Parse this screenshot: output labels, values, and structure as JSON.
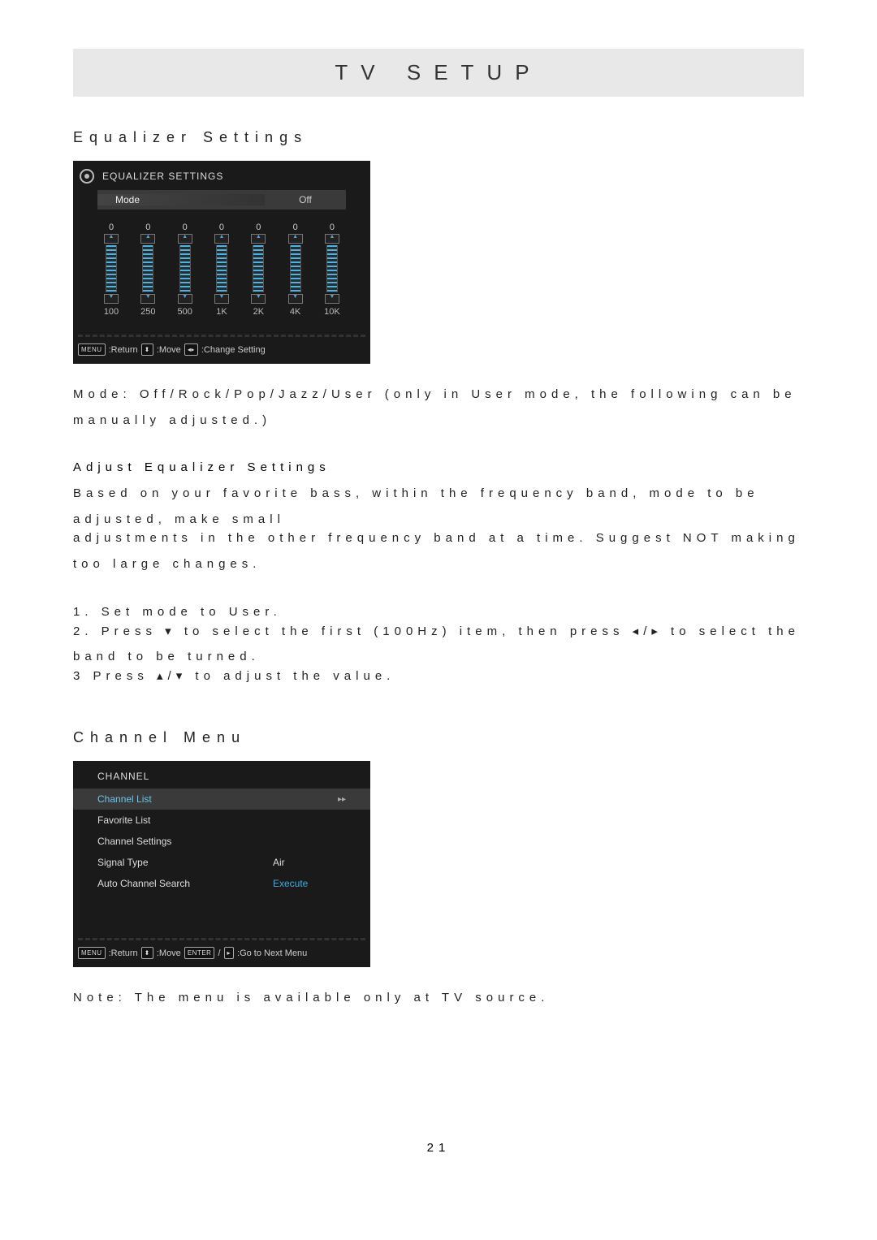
{
  "page": {
    "title": "TV SETUP",
    "number": "21"
  },
  "sections": {
    "equalizer_title": "Equalizer Settings",
    "channel_title": "Channel Menu"
  },
  "equalizer_panel": {
    "title": "EQUALIZER SETTINGS",
    "mode_label": "Mode",
    "mode_value": "Off",
    "bands": [
      {
        "value": "0",
        "freq": "100"
      },
      {
        "value": "0",
        "freq": "250"
      },
      {
        "value": "0",
        "freq": "500"
      },
      {
        "value": "0",
        "freq": "1K"
      },
      {
        "value": "0",
        "freq": "2K"
      },
      {
        "value": "0",
        "freq": "4K"
      },
      {
        "value": "0",
        "freq": "10K"
      }
    ],
    "hints": {
      "menu": "MENU",
      "return": ":Return",
      "move_key": "⬍",
      "move": ":Move",
      "lr_key": "◂▸",
      "change": ":Change Setting"
    }
  },
  "text": {
    "modes": "Mode: Off/Rock/Pop/Jazz/User (only in User mode, the following can be manually adjusted.)",
    "adjust_heading": "Adjust Equalizer Settings",
    "adjust_p1": "Based on your favorite bass, within the frequency band, mode to be adjusted, make small",
    "adjust_p2": "adjustments in the other frequency band at a time. Suggest NOT making too large changes.",
    "step1": "1. Set mode to User.",
    "step2": "2. Press ▾ to select the first (100Hz) item, then press ◂/▸ to select the band to be turned.",
    "step3": "3 Press ▴/▾ to adjust the value.",
    "note": "Note: The menu is available only at TV source."
  },
  "channel_panel": {
    "title": "CHANNEL",
    "rows": [
      {
        "label": "Channel List",
        "value": "",
        "selected": true,
        "arrow": "▸▸"
      },
      {
        "label": "Favorite List",
        "value": "",
        "selected": false
      },
      {
        "label": "Channel Settings",
        "value": "",
        "selected": false
      },
      {
        "label": "Signal Type",
        "value": "Air",
        "selected": false
      },
      {
        "label": "Auto Channel Search",
        "value": "Execute",
        "selected": false,
        "exec": true
      }
    ],
    "hints": {
      "menu": "MENU",
      "return": ":Return",
      "move_key": "⬍",
      "move": ":Move",
      "enter": "ENTER",
      "slash": "/",
      "right": "▸",
      "next": ":Go to Next Menu"
    }
  }
}
